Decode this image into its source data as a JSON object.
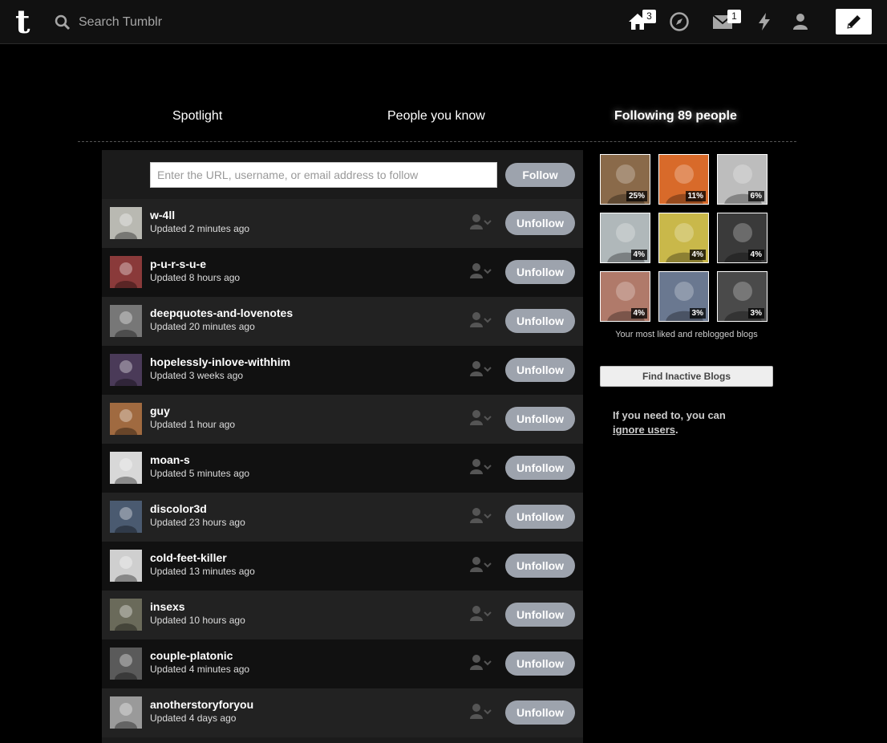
{
  "topbar": {
    "search_placeholder": "Search Tumblr",
    "home_badge": "3",
    "inbox_badge": "1",
    "icons": [
      "tumblr-logo-icon",
      "search-icon",
      "home-icon",
      "explore-compass-icon",
      "inbox-envelope-icon",
      "activity-lightning-icon",
      "account-person-icon",
      "compose-pencil-icon"
    ]
  },
  "tabs": {
    "spotlight": "Spotlight",
    "people_you_know": "People you know",
    "following": "Following 89 people"
  },
  "follow": {
    "placeholder": "Enter the URL, username, or email address to follow",
    "button": "Follow"
  },
  "unfollow_label": "Unfollow",
  "following": [
    {
      "name": "w-4ll",
      "updated": "Updated 2 minutes ago",
      "avatar_color": "#b9b9b2"
    },
    {
      "name": "p-u-r-s-u-e",
      "updated": "Updated 8 hours ago",
      "avatar_color": "#8a3a3a"
    },
    {
      "name": "deepquotes-and-lovenotes",
      "updated": "Updated 20 minutes ago",
      "avatar_color": "#777777"
    },
    {
      "name": "hopelessly-inlove-withhim",
      "updated": "Updated 3 weeks ago",
      "avatar_color": "#4a3a58"
    },
    {
      "name": "guy",
      "updated": "Updated 1 hour ago",
      "avatar_color": "#a06a40"
    },
    {
      "name": "moan-s",
      "updated": "Updated 5 minutes ago",
      "avatar_color": "#d8d8d8"
    },
    {
      "name": "discolor3d",
      "updated": "Updated 23 hours ago",
      "avatar_color": "#4a5a70"
    },
    {
      "name": "cold-feet-killer",
      "updated": "Updated 13 minutes ago",
      "avatar_color": "#cfcfcf"
    },
    {
      "name": "insexs",
      "updated": "Updated 10 hours ago",
      "avatar_color": "#6a6a5a"
    },
    {
      "name": "couple-platonic",
      "updated": "Updated 4 minutes ago",
      "avatar_color": "#5a5a5a"
    },
    {
      "name": "anotherstoryforyou",
      "updated": "Updated 4 days ago",
      "avatar_color": "#9a9a9a"
    }
  ],
  "top_blogs": [
    {
      "percent": "25%",
      "color": "#8a6a4a"
    },
    {
      "percent": "11%",
      "color": "#d86a2a"
    },
    {
      "percent": "6%",
      "color": "#bdbdbd"
    },
    {
      "percent": "4%",
      "color": "#b0b8ba"
    },
    {
      "percent": "4%",
      "color": "#c9b84a"
    },
    {
      "percent": "4%",
      "color": "#3a3a3a"
    },
    {
      "percent": "4%",
      "color": "#b07a6a"
    },
    {
      "percent": "3%",
      "color": "#6a7890"
    },
    {
      "percent": "3%",
      "color": "#4a4a4a"
    }
  ],
  "sidebar": {
    "caption": "Your most liked and reblogged blogs",
    "find_inactive": "Find Inactive Blogs",
    "ignore_prefix": "If you need to, you can",
    "ignore_link": "ignore users",
    "ignore_suffix": "."
  }
}
